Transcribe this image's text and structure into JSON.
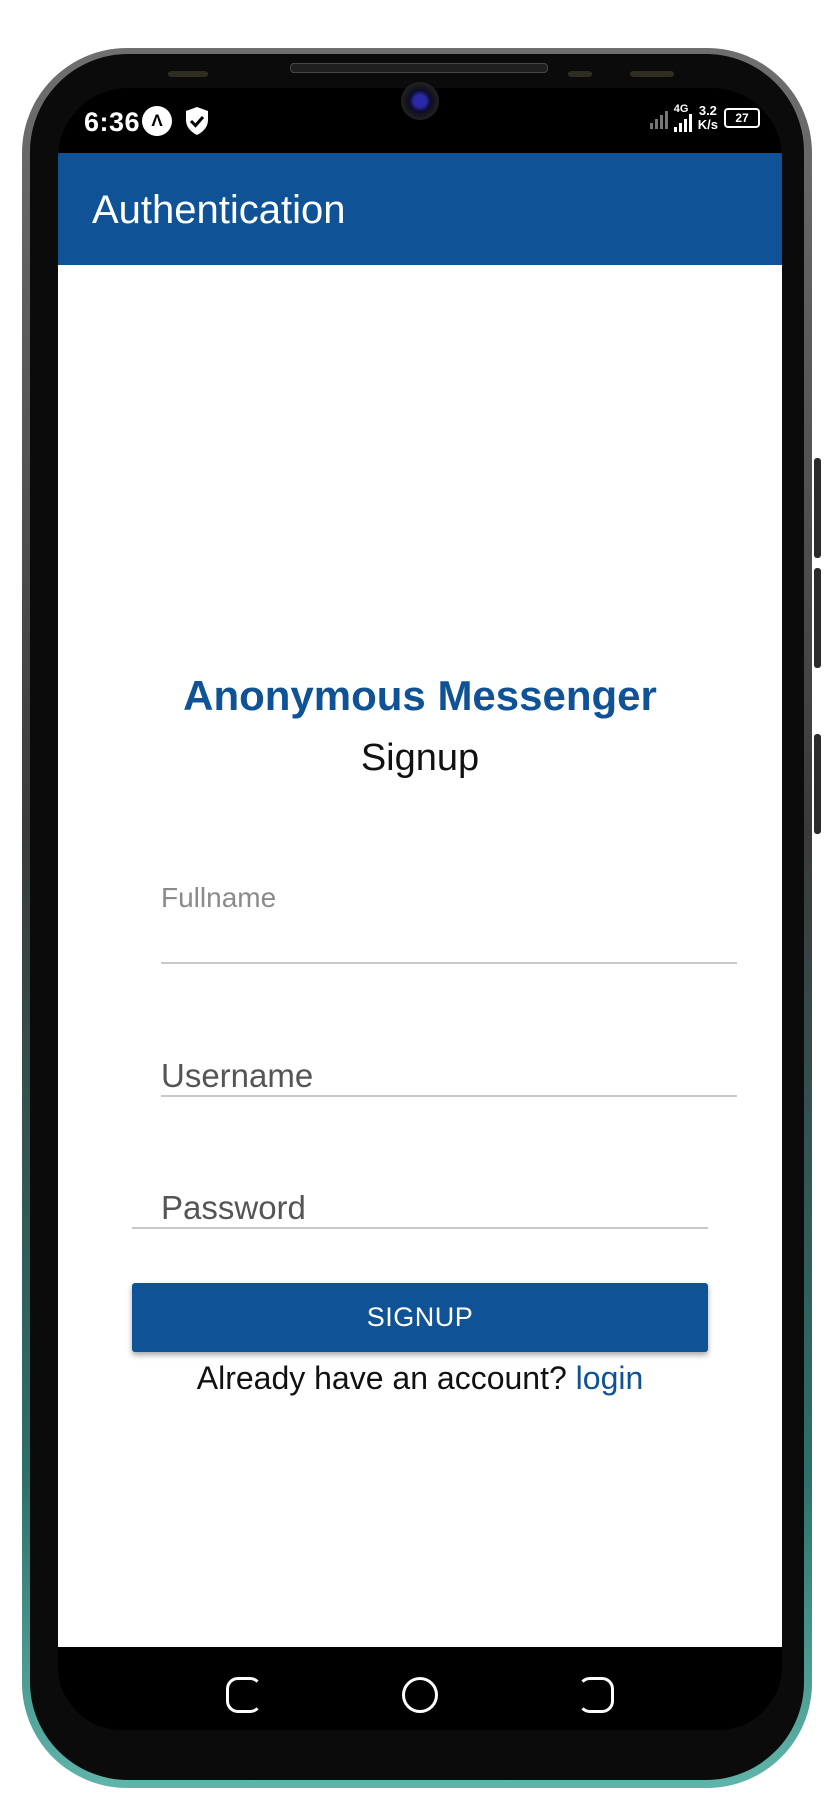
{
  "status_bar": {
    "time": "6:36",
    "app_icons": [
      "alpha-icon",
      "shield-check-icon"
    ],
    "network_type": "4G",
    "net_speed_value": "3.2",
    "net_speed_unit": "K/s",
    "battery_level": "27"
  },
  "app_bar": {
    "title": "Authentication"
  },
  "form": {
    "brand_title": "Anonymous Messenger",
    "subtitle": "Signup",
    "fullname": {
      "label": "Fullname",
      "value": ""
    },
    "username": {
      "placeholder": "Username",
      "value": ""
    },
    "password": {
      "placeholder": "Password",
      "value": ""
    },
    "submit_label": "SIGNUP",
    "account_prompt": "Already have an account?",
    "login_link": "login"
  },
  "nav_bar": {
    "buttons": [
      "back-icon",
      "home-icon",
      "recents-icon"
    ]
  },
  "colors": {
    "primary": "#0f5296",
    "background": "#ffffff",
    "field_line": "#c9c9c9"
  }
}
